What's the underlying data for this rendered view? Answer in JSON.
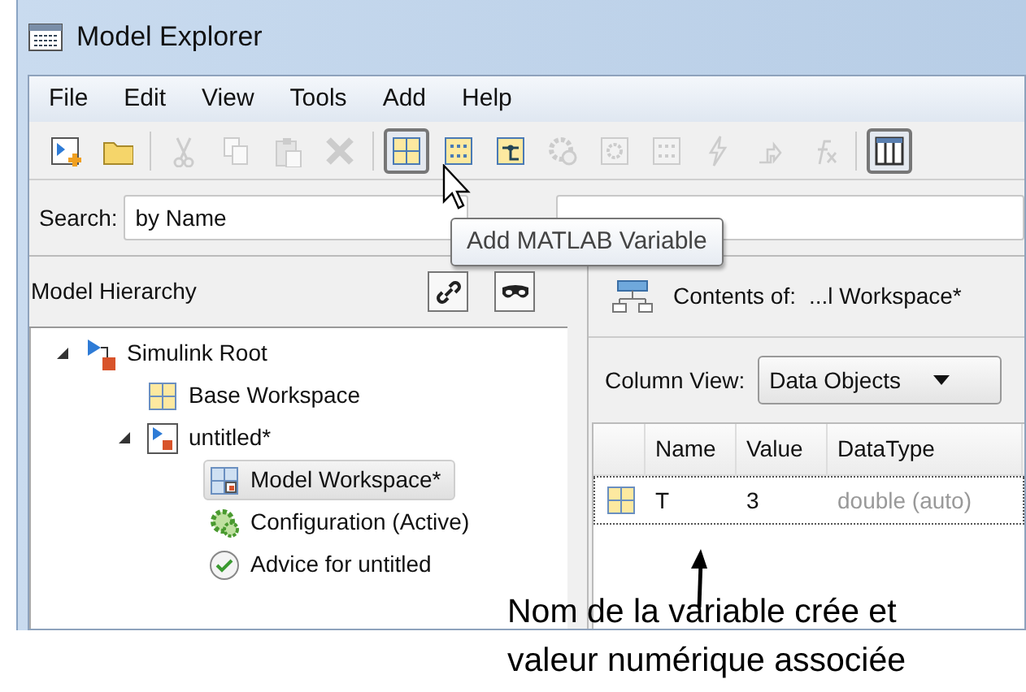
{
  "window": {
    "title": "Model Explorer"
  },
  "menu": [
    "File",
    "Edit",
    "View",
    "Tools",
    "Add",
    "Help"
  ],
  "toolbar": [
    {
      "kind": "new-model",
      "disabled": false,
      "highlighted": false
    },
    {
      "kind": "folder",
      "disabled": false,
      "highlighted": false
    },
    {
      "kind": "separator"
    },
    {
      "kind": "cut",
      "disabled": true,
      "highlighted": false
    },
    {
      "kind": "copy",
      "disabled": true,
      "highlighted": false
    },
    {
      "kind": "paste",
      "disabled": true,
      "highlighted": false
    },
    {
      "kind": "delete",
      "disabled": true,
      "highlighted": false
    },
    {
      "kind": "separator"
    },
    {
      "kind": "variable",
      "disabled": false,
      "highlighted": true
    },
    {
      "kind": "binary",
      "disabled": false,
      "highlighted": false
    },
    {
      "kind": "block",
      "disabled": false,
      "highlighted": false
    },
    {
      "kind": "gear",
      "disabled": true,
      "highlighted": false
    },
    {
      "kind": "gear-box",
      "disabled": true,
      "highlighted": false
    },
    {
      "kind": "binary",
      "disabled": true,
      "highlighted": false
    },
    {
      "kind": "bolt",
      "disabled": true,
      "highlighted": false
    },
    {
      "kind": "step",
      "disabled": true,
      "highlighted": false
    },
    {
      "kind": "fx",
      "disabled": true,
      "highlighted": false
    },
    {
      "kind": "separator"
    },
    {
      "kind": "columns",
      "disabled": false,
      "highlighted": true
    }
  ],
  "search": {
    "label": "Search:",
    "value": "by Name"
  },
  "tooltip": "Add MATLAB Variable",
  "hierarchy": {
    "title": "Model Hierarchy",
    "tree": [
      {
        "label": "Simulink Root",
        "kind": "root",
        "expanded": true,
        "selected": false,
        "children": [
          {
            "label": "Base Workspace",
            "kind": "workspace",
            "selected": false
          },
          {
            "label": "untitled*",
            "kind": "model",
            "expanded": true,
            "selected": false,
            "children": [
              {
                "label": "Model Workspace*",
                "kind": "model-workspace",
                "selected": true
              },
              {
                "label": "Configuration (Active)",
                "kind": "config",
                "selected": false
              },
              {
                "label": "Advice for untitled",
                "kind": "advice",
                "selected": false
              }
            ]
          }
        ]
      }
    ]
  },
  "contents": {
    "title": "Contents of:",
    "path": "...l Workspace*",
    "column_view_label": "Column View:",
    "column_view": "Data Objects",
    "columns": [
      "Name",
      "Value",
      "DataType"
    ],
    "rows": [
      {
        "name": "T",
        "value": "3",
        "datatype": "double (auto)"
      }
    ]
  },
  "annotation": {
    "line_1": "Nom de la variable crée et",
    "line_2": "valeur numérique associée"
  }
}
